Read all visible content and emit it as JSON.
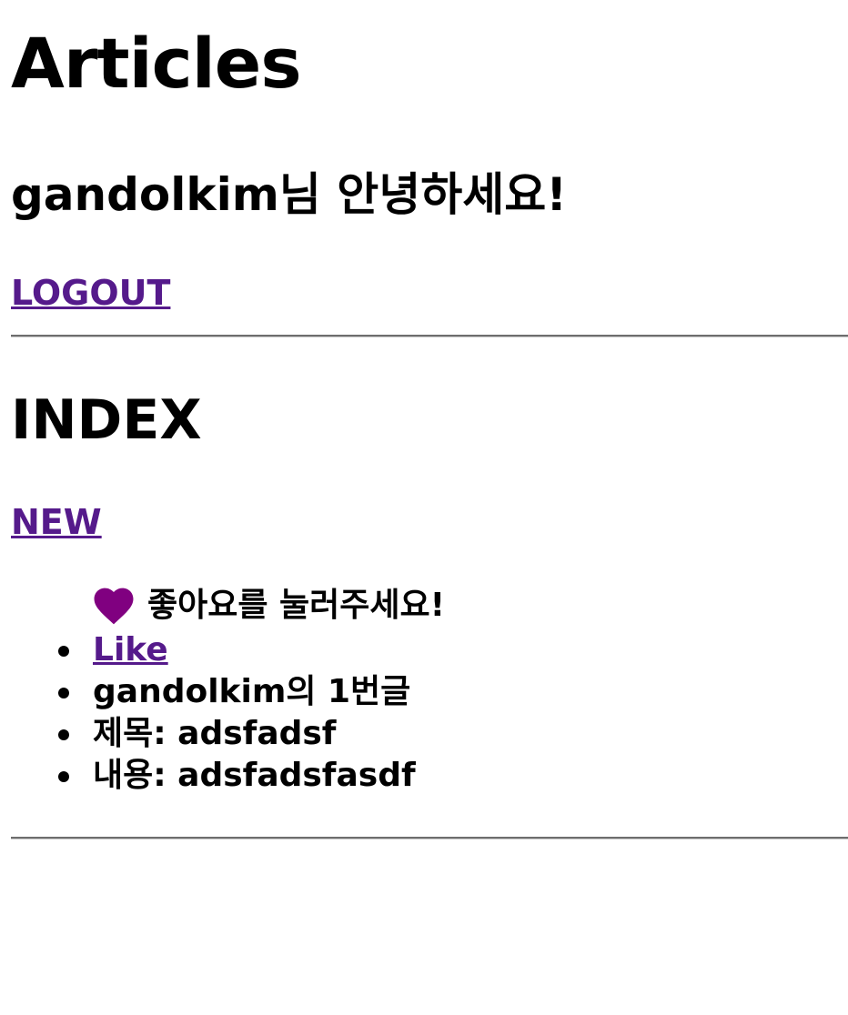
{
  "colors": {
    "link": "#551a8b",
    "heart": "#800080",
    "text": "#000000"
  },
  "header": {
    "title": "Articles",
    "greeting": "gandolkim님 안녕하세요!",
    "logout_label": "LOGOUT"
  },
  "index": {
    "title": "INDEX",
    "new_label": "NEW"
  },
  "article": {
    "heart_icon": "heart-icon",
    "like_message": "좋아요를 눌러주세요!",
    "like_label": "Like",
    "author_line": "gandolkim의 1번글",
    "title_line": "제목: adsfadsf",
    "content_line": "내용: adsfadsfasdf"
  }
}
